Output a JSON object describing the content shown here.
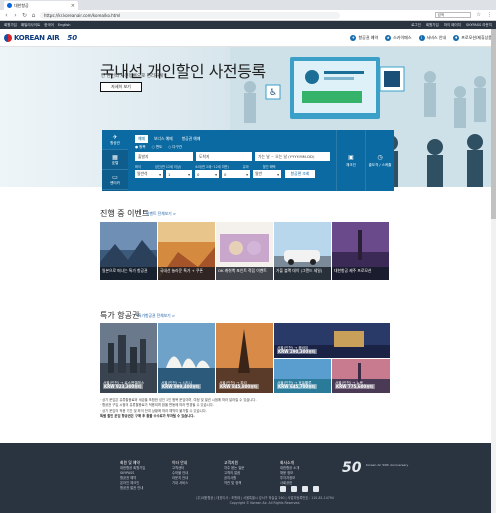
{
  "browser": {
    "tab_title": "대한항공",
    "url": "https://kr.koreanair.com/korea/ko.html",
    "search_placeholder": "검색"
  },
  "utility_bar": {
    "left": [
      "회원가입",
      "패밀리사이트",
      "한국어",
      "English"
    ],
    "right": [
      "로그인",
      "회원가입",
      "마이 페이지",
      "SKYPASS 라운지"
    ]
  },
  "header": {
    "logo_text": "KOREAN AIR",
    "anniversary_mark": "50",
    "menu": [
      "항공권 예약",
      "스카이패스",
      "서비스 안내",
      "프로모션/제휴상품"
    ]
  },
  "hero": {
    "title": "국내선 개인할인 사전등록",
    "subtitle": "단 한번의 사전등록으로 편리하게!",
    "button": "자세히 보기"
  },
  "booking": {
    "side_tabs": [
      "항공권",
      "호텔",
      "렌터카"
    ],
    "tabs": [
      "예매",
      "보너스 예매",
      "항공권 예매"
    ],
    "radios": [
      "왕복",
      "편도",
      "다구간"
    ],
    "departure_placeholder": "출발지",
    "arrival_placeholder": "도착지",
    "date_placeholder": "가는 날 ~ 오는 날 (YYYY.MM.DD)",
    "selects": [
      "일반석",
      "1",
      "0",
      "0",
      "일반"
    ],
    "select_labels": [
      "좌석",
      "성인(만 12세 이상)",
      "소아(만 2세~12세 미만)",
      "유아",
      "할인 혜택"
    ],
    "search_button": "항공편 조회",
    "right_buttons": [
      "체크인",
      "출도착 / 스케줄"
    ]
  },
  "events": {
    "title": "진행 중 이벤트",
    "more_link": "이벤트 전체보기 >",
    "cards": [
      "일본으로 떠나는 특가 항공권",
      "국내선 놀라운 특가 + 쿠폰",
      "OK 캐쉬백 포인트 적립 이벤트",
      "가을 블랙 데이 (그랜드 세일)",
      "대한항공 제주 프로모션"
    ]
  },
  "fares": {
    "title": "특가 항공권",
    "more_link": "특가항공권 전체보기 >",
    "cards": [
      {
        "route": "서울(인천) → 로스앤젤레스",
        "price": "KRW 923,300부터"
      },
      {
        "route": "서울(인천) → 시드니",
        "price": "KRW 999,400부터"
      },
      {
        "route": "서울(인천) → 파리",
        "price": "KRW 845,800부터"
      },
      {
        "route": "서울(인천) → 뭄바이",
        "price": "KRW 290,300부터"
      },
      {
        "route": "서울(인천) → 호놀룰루",
        "price": "KRW 645,700부터"
      },
      {
        "route": "서울(인천) → 뉴욕",
        "price": "KRW 775,600부터"
      }
    ]
  },
  "notes": [
    "· 상기 운임은 유류할증료와 세금을 포함한 성인 1인 왕복 운임이며, 여정 및 발권 시점에 따라 달라질 수 있습니다.",
    "· 항공권 구입 시점의 유류할증료가 적용되며 환율 변동에 따라 변경될 수 있습니다.",
    "· 상기 운임의 적용 기간 및 좌석 잔여 상황에 따라 예약이 불가할 수 있습니다.",
    "특별 할인 운임 항공권은 구매 후 환불 수수료가 부과될 수 있습니다."
  ],
  "footer": {
    "columns": [
      {
        "title": "회원 및 예약",
        "items": [
          "대한항공 회원가입",
          "SKYPASS",
          "항공권 예약",
          "온라인 체크인",
          "항공권 발권 안내"
        ]
      },
      {
        "title": "이타 안내",
        "items": [
          "고객센터",
          "수하물 안내",
          "라운지 안내",
          "기내 서비스"
        ]
      },
      {
        "title": "고객지원",
        "items": [
          "자주 묻는 질문",
          "고객의 말씀",
          "공지사항",
          "약관 및 정책"
        ]
      },
      {
        "title": "회사소개",
        "items": [
          "대한항공 소개",
          "채용 정보",
          "투자자정보",
          "사회공헌"
        ]
      }
    ],
    "anniversary": "50",
    "anniversary_sub": "Korean Air 50th Anniversary",
    "company_lines": [
      "(주)대한항공 | 대표이사 : 조원태 | 서울특별시 강서구 하늘길 260 | 사업자등록번호 : 110-81-14794",
      "Copyright © Korean Air. All Rights Reserved."
    ]
  }
}
